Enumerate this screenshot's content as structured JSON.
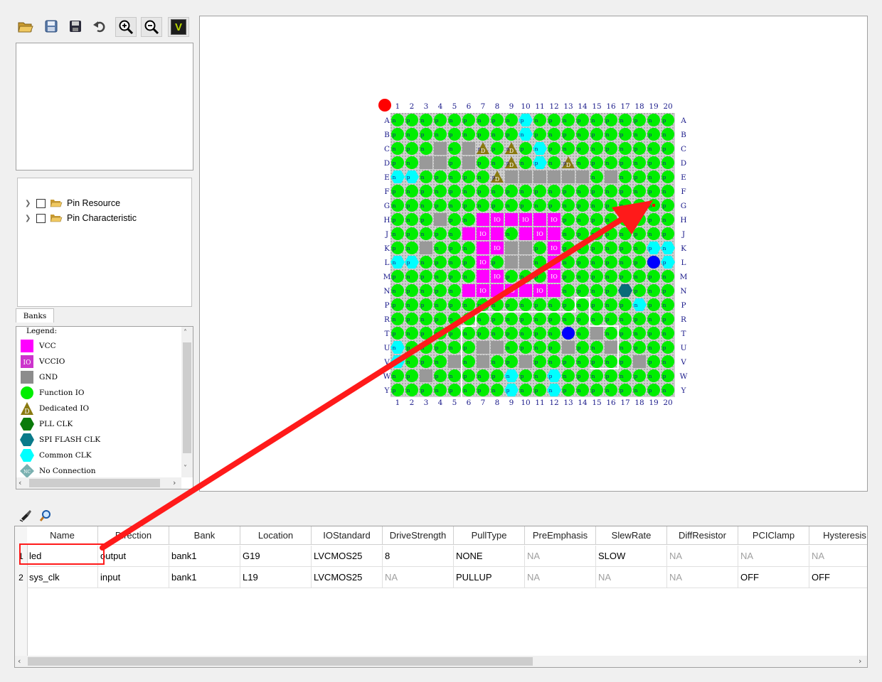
{
  "toolbar": {
    "buttons": [
      {
        "name": "open-folder-icon"
      },
      {
        "name": "save-icon"
      },
      {
        "name": "save-as-icon"
      },
      {
        "name": "undo-icon"
      },
      {
        "name": "zoom-in-icon"
      },
      {
        "name": "zoom-out-icon"
      },
      {
        "name": "validate-icon",
        "glyph": "V"
      }
    ]
  },
  "tree": {
    "items": [
      {
        "label": "Pin Resource"
      },
      {
        "label": "Pin Characteristic"
      }
    ]
  },
  "banks_tab": {
    "label": "Banks"
  },
  "legend": {
    "title": "Legend:",
    "items": [
      {
        "label": "VCC",
        "symbol": "square",
        "color": "#ff00ff"
      },
      {
        "label": "VCCIO",
        "symbol": "square-io",
        "color": "#cc33cc",
        "glyph": "IO"
      },
      {
        "label": "GND",
        "symbol": "square",
        "color": "#8c8c8c"
      },
      {
        "label": "Function IO",
        "symbol": "circle",
        "color": "#00ee00"
      },
      {
        "label": "Dedicated IO",
        "symbol": "triangle",
        "color": "#8a7a10",
        "glyph": "D"
      },
      {
        "label": "PLL CLK",
        "symbol": "hexagon",
        "color": "#0a7a0a"
      },
      {
        "label": "SPI FLASH CLK",
        "symbol": "hexagon",
        "color": "#0a7a8a"
      },
      {
        "label": "Common CLK",
        "symbol": "hexagon",
        "color": "#00ffff"
      },
      {
        "label": "No Connection",
        "symbol": "diamond",
        "color": "#7ab0b0",
        "glyph": "NC"
      }
    ]
  },
  "package": {
    "corner_marker_color": "#ff0000",
    "columns": [
      "1",
      "2",
      "3",
      "4",
      "5",
      "6",
      "7",
      "8",
      "9",
      "10",
      "11",
      "12",
      "13",
      "14",
      "15",
      "16",
      "17",
      "18",
      "19",
      "20"
    ],
    "rows": [
      "A",
      "B",
      "C",
      "D",
      "E",
      "F",
      "G",
      "H",
      "J",
      "K",
      "L",
      "M",
      "N",
      "P",
      "R",
      "T",
      "U",
      "V",
      "W",
      "Y"
    ],
    "pin_letters": [
      "n",
      "p"
    ],
    "vccio_glyph": "IO",
    "dedicated_glyph": "D",
    "colors": {
      "function_io": "#00ee00",
      "vccio": "#ff00ff",
      "gnd": "#999999",
      "common_clk": "#00ffff",
      "dedicated": "#8a7a10",
      "assigned": "#0000ff",
      "spi_clk": "#0a6a7a"
    }
  },
  "pin_table": {
    "toolbar": [
      {
        "name": "clear-icon"
      },
      {
        "name": "search-icon"
      }
    ],
    "columns": [
      "Name",
      "Direction",
      "Bank",
      "Location",
      "IOStandard",
      "DriveStrength",
      "PullType",
      "PreEmphasis",
      "SlewRate",
      "DiffResistor",
      "PCIClamp",
      "Hysteresis"
    ],
    "rows": [
      {
        "num": "1",
        "cells": [
          "led",
          "output",
          "bank1",
          "G19",
          "LVCMOS25",
          "8",
          "NONE",
          "NA",
          "SLOW",
          "NA",
          "NA",
          "NA"
        ]
      },
      {
        "num": "2",
        "cells": [
          "sys_clk",
          "input",
          "bank1",
          "L19",
          "LVCMOS25",
          "NA",
          "PULLUP",
          "NA",
          "NA",
          "NA",
          "OFF",
          "OFF"
        ]
      }
    ]
  },
  "annotation": {
    "color": "#ff1a1a"
  }
}
